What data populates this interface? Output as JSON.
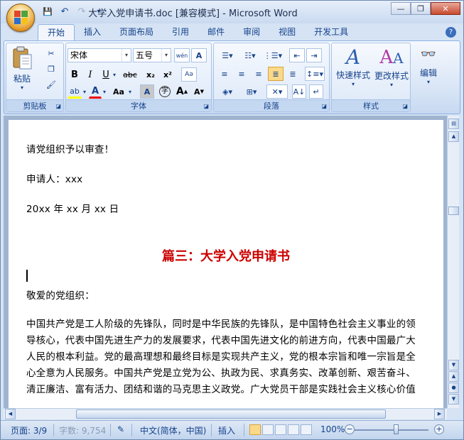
{
  "window": {
    "title": "大学入党申请书.doc [兼容模式] - Microsoft Word",
    "minimize": "—",
    "restore": "❐",
    "close": "✕"
  },
  "qat": {
    "save_icon": "💾",
    "undo_icon": "↶",
    "redo_icon": "↷",
    "customize_icon": "▾"
  },
  "tabs": [
    "开始",
    "插入",
    "页面布局",
    "引用",
    "邮件",
    "审阅",
    "视图",
    "开发工具"
  ],
  "help_label": "?",
  "ribbon": {
    "clipboard": {
      "label": "剪贴板",
      "paste": "粘贴"
    },
    "font": {
      "label": "字体",
      "font_name": "宋体",
      "font_size": "五号",
      "bold": "B",
      "italic": "I",
      "underline": "U",
      "strike": "abc",
      "subscript": "x₂",
      "superscript": "x²",
      "change_case": "Aa",
      "grow": "A",
      "shrink": "A"
    },
    "paragraph": {
      "label": "段落"
    },
    "styles": {
      "label": "样式",
      "quick_styles": "快速样式",
      "change_styles": "更改样式"
    },
    "editing": {
      "label": "编辑"
    }
  },
  "document": {
    "lines": [
      "请党组织予以审查！",
      "申请人：xxx",
      "20xx 年 xx 月 xx 日",
      "敬爱的党组织：",
      "中国共产党是工人阶级的先锋队，同时是中华民族的先锋队，是中国特色社会主义事业的领",
      "导核心，代表中国先进生产力的发展要求，代表中国先进文化的前进方向，代表中国最广大",
      "人民的根本利益。党的最高理想和最终目标是实现共产主义，党的根本宗旨和唯一宗旨是全",
      "心全意为人民服务。中国共产党是立党为公、执政为民、求真务实、改革创新、艰苦奋斗、",
      "清正廉洁、富有活力、团结和谐的马克思主义政党。广大党员干部是实践社会主义核心价值"
    ],
    "heading": "篇三：大学入党申请书"
  },
  "status": {
    "page": "页面: 3/9",
    "words": "字数: 9,754",
    "language": "中文(简体，中国)",
    "mode": "插入",
    "zoom": "100%",
    "zoom_minus": "−",
    "zoom_plus": "+"
  },
  "colors": {
    "accent": "#15428b",
    "heading": "#cc0000",
    "ribbon": "#dbe7f7"
  }
}
